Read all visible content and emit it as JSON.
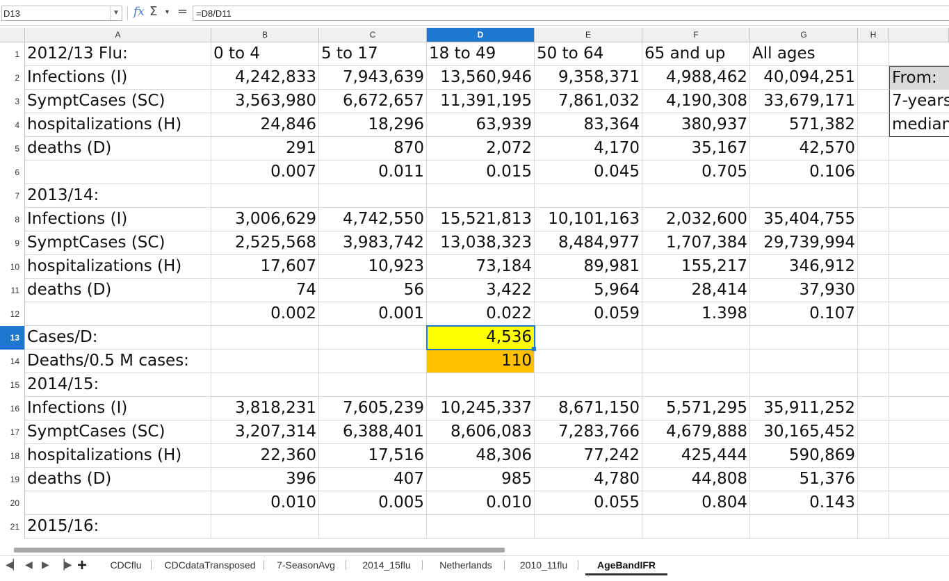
{
  "formula_bar": {
    "name_box": "D13",
    "formula": "=D8/D11",
    "fx": "fx",
    "sigma": "Σ",
    "equals": "="
  },
  "columns": [
    "A",
    "B",
    "C",
    "D",
    "E",
    "F",
    "G",
    "H"
  ],
  "selected_column": "D",
  "selected_row": "13",
  "rows": [
    {
      "n": "1",
      "cells": [
        "2012/13 Flu:",
        "0 to 4",
        "5 to 17",
        "18 to 49",
        "50 to 64",
        "65 and up",
        "All ages",
        ""
      ]
    },
    {
      "n": "2",
      "cells": [
        "Infections (I)",
        "4,242,833",
        "7,943,639",
        "13,560,946",
        "9,358,371",
        "4,988,462",
        "40,094,251",
        ""
      ]
    },
    {
      "n": "3",
      "cells": [
        "SymptCases (SC)",
        "3,563,980",
        "6,672,657",
        "11,391,195",
        "7,861,032",
        "4,190,308",
        "33,679,171",
        ""
      ]
    },
    {
      "n": "4",
      "cells": [
        "hospitalizations (H)",
        "24,846",
        "18,296",
        "63,939",
        "83,364",
        "380,937",
        "571,382",
        ""
      ]
    },
    {
      "n": "5",
      "cells": [
        "deaths (D)",
        "291",
        "870",
        "2,072",
        "4,170",
        "35,167",
        "42,570",
        ""
      ]
    },
    {
      "n": "6",
      "cells": [
        "",
        "0.007",
        "0.011",
        "0.015",
        "0.045",
        "0.705",
        "0.106",
        ""
      ]
    },
    {
      "n": "7",
      "cells": [
        "2013/14:",
        "",
        "",
        "",
        "",
        "",
        "",
        ""
      ]
    },
    {
      "n": "8",
      "cells": [
        "Infections (I)",
        "3,006,629",
        "4,742,550",
        "15,521,813",
        "10,101,163",
        "2,032,600",
        "35,404,755",
        ""
      ]
    },
    {
      "n": "9",
      "cells": [
        "SymptCases (SC)",
        "2,525,568",
        "3,983,742",
        "13,038,323",
        "8,484,977",
        "1,707,384",
        "29,739,994",
        ""
      ]
    },
    {
      "n": "10",
      "cells": [
        "hospitalizations (H)",
        "17,607",
        "10,923",
        "73,184",
        "89,981",
        "155,217",
        "346,912",
        ""
      ]
    },
    {
      "n": "11",
      "cells": [
        "deaths (D)",
        "74",
        "56",
        "3,422",
        "5,964",
        "28,414",
        "37,930",
        ""
      ]
    },
    {
      "n": "12",
      "cells": [
        "",
        "0.002",
        "0.001",
        "0.022",
        "0.059",
        "1.398",
        "0.107",
        ""
      ]
    },
    {
      "n": "13",
      "cells": [
        "Cases/D:",
        "",
        "",
        "4,536",
        "",
        "",
        "",
        ""
      ]
    },
    {
      "n": "14",
      "cells": [
        "Deaths/0.5 M cases:",
        "",
        "",
        "110",
        "",
        "",
        "",
        ""
      ]
    },
    {
      "n": "15",
      "cells": [
        "2014/15:",
        "",
        "",
        "",
        "",
        "",
        "",
        ""
      ]
    },
    {
      "n": "16",
      "cells": [
        "Infections (I)",
        "3,818,231",
        "7,605,239",
        "10,245,337",
        "8,671,150",
        "5,571,295",
        "35,911,252",
        ""
      ]
    },
    {
      "n": "17",
      "cells": [
        "SymptCases (SC)",
        "3,207,314",
        "6,388,401",
        "8,606,083",
        "7,283,766",
        "4,679,888",
        "30,165,452",
        ""
      ]
    },
    {
      "n": "18",
      "cells": [
        "hospitalizations (H)",
        "22,360",
        "17,516",
        "48,306",
        "77,242",
        "425,444",
        "590,869",
        ""
      ]
    },
    {
      "n": "19",
      "cells": [
        "deaths (D)",
        "396",
        "407",
        "985",
        "4,780",
        "44,808",
        "51,376",
        ""
      ]
    },
    {
      "n": "20",
      "cells": [
        "",
        "0.010",
        "0.005",
        "0.010",
        "0.055",
        "0.804",
        "0.143",
        ""
      ]
    },
    {
      "n": "21",
      "cells": [
        "2015/16:",
        "",
        "",
        "",
        "",
        "",
        "",
        ""
      ]
    }
  ],
  "side_box": [
    "From:",
    "7-years",
    "median"
  ],
  "cell_colors": {
    "D13": "#ffff00",
    "D14": "#ffc000",
    "side_header": "#d9d9d9"
  },
  "sheet_tabs": [
    "CDCflu",
    "CDCdataTransposed",
    "7-SeasonAvg",
    "2014_15flu",
    "Netherlands",
    "2010_11flu",
    "AgeBandIFR"
  ],
  "active_tab": "AgeBandIFR"
}
